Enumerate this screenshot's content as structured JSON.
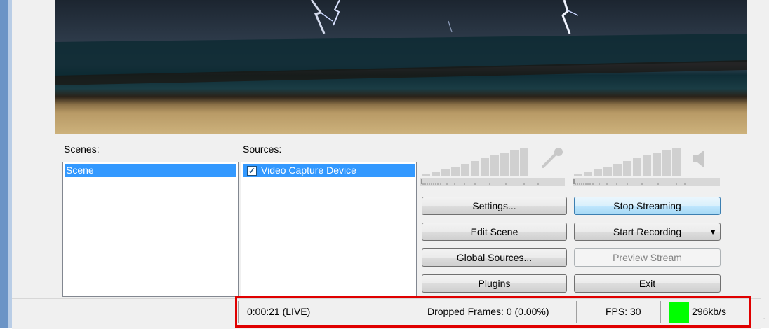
{
  "scenes": {
    "label": "Scenes:",
    "items": [
      "Scene"
    ]
  },
  "sources": {
    "label": "Sources:",
    "items": [
      {
        "label": "Video Capture Device",
        "checked": true
      }
    ]
  },
  "buttons": {
    "settings": "Settings...",
    "edit_scene": "Edit Scene",
    "global_sources": "Global Sources...",
    "plugins": "Plugins",
    "stop_streaming": "Stop Streaming",
    "start_recording": "Start Recording",
    "preview_stream": "Preview Stream",
    "exit": "Exit"
  },
  "audio": {
    "mic_icon": "microphone-icon",
    "speaker_icon": "speaker-icon"
  },
  "status": {
    "time": "0:00:21 (LIVE)",
    "dropped_frames": "Dropped Frames: 0 (0.00%)",
    "fps": "FPS: 30",
    "bitrate": "296kb/s",
    "bitrate_color": "#00ff00"
  },
  "colors": {
    "highlight": "#e00000",
    "selection": "#3399ff",
    "window_border": "#6b94c6"
  }
}
